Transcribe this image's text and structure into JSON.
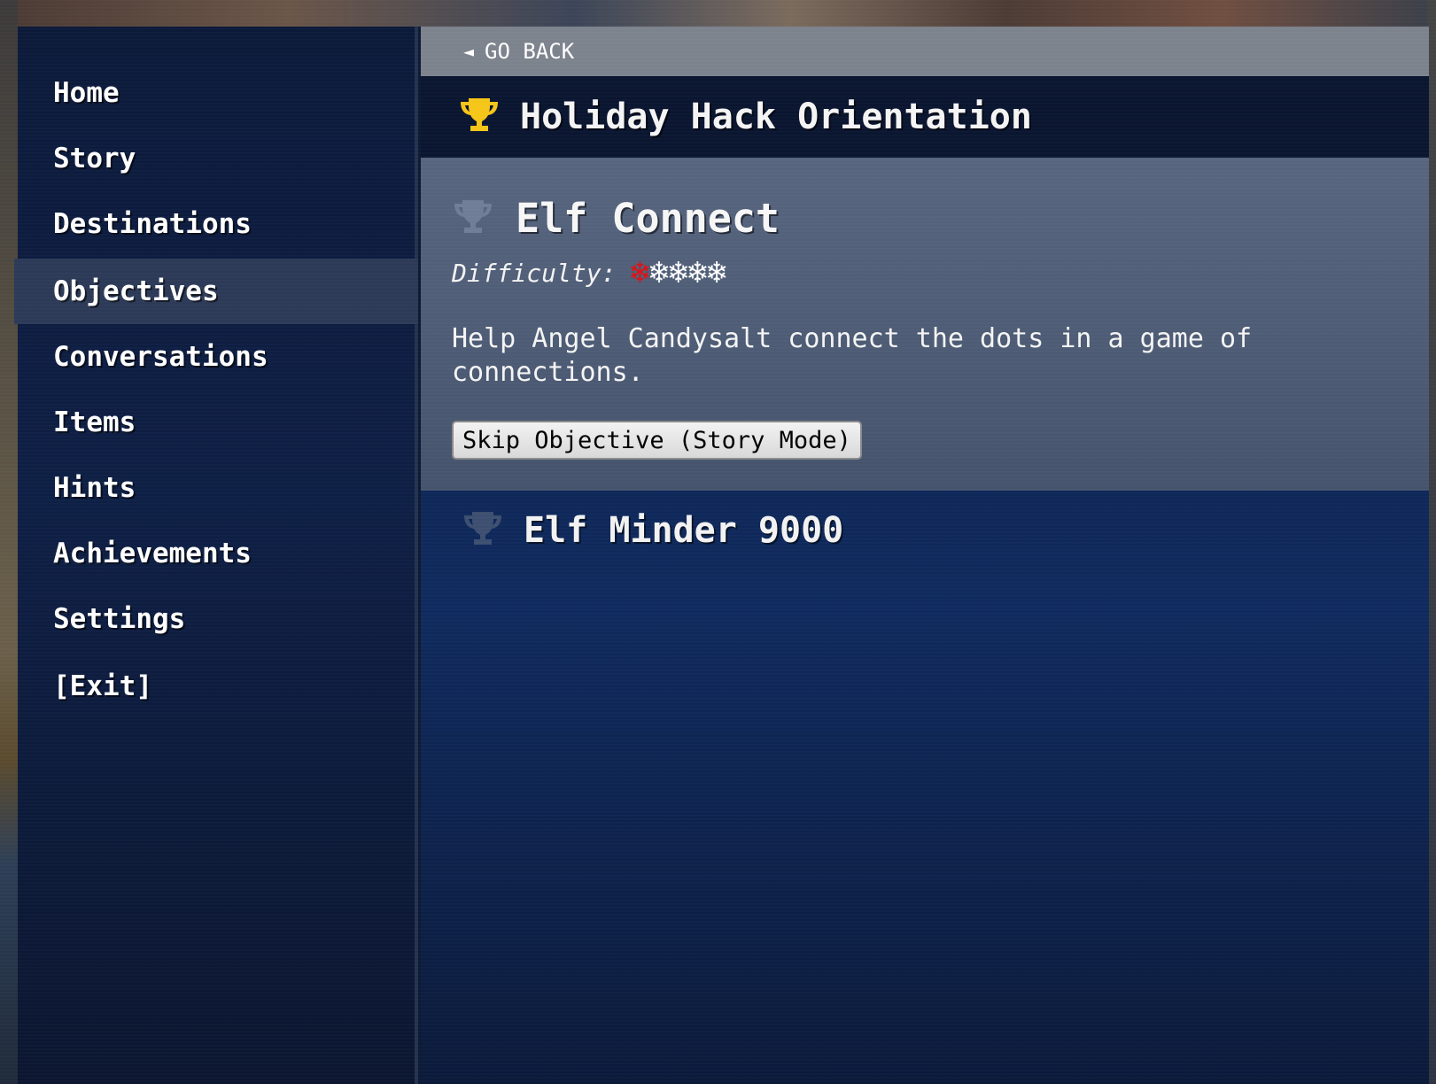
{
  "sidebar": {
    "items": [
      {
        "label": "Home"
      },
      {
        "label": "Story"
      },
      {
        "label": "Destinations"
      },
      {
        "label": "Objectives",
        "active": true
      },
      {
        "label": "Conversations"
      },
      {
        "label": "Items"
      },
      {
        "label": "Hints"
      },
      {
        "label": "Achievements"
      },
      {
        "label": "Settings"
      },
      {
        "label": "[Exit]"
      }
    ]
  },
  "nav": {
    "go_back_arrow": "◄",
    "go_back_label": "GO BACK"
  },
  "header": {
    "icon": "trophy-icon",
    "icon_color": "#f5c518",
    "title": "Holiday Hack Orientation"
  },
  "objective": {
    "icon": "trophy-icon",
    "icon_color": "#6f7d96",
    "title": "Elf Connect",
    "difficulty_label": "Difficulty:",
    "difficulty_level": 1,
    "difficulty_max": 5,
    "difficulty_glyph": "❄",
    "difficulty_color_on": "#e01010",
    "difficulty_color_off": "#ffffff",
    "description": "Help Angel Candysalt connect the dots in a game of connections.",
    "skip_button_label": "Skip Objective (Story Mode)"
  },
  "next_objective": {
    "icon": "trophy-icon",
    "icon_color": "#3d4f70",
    "title": "Elf Minder 9000"
  }
}
